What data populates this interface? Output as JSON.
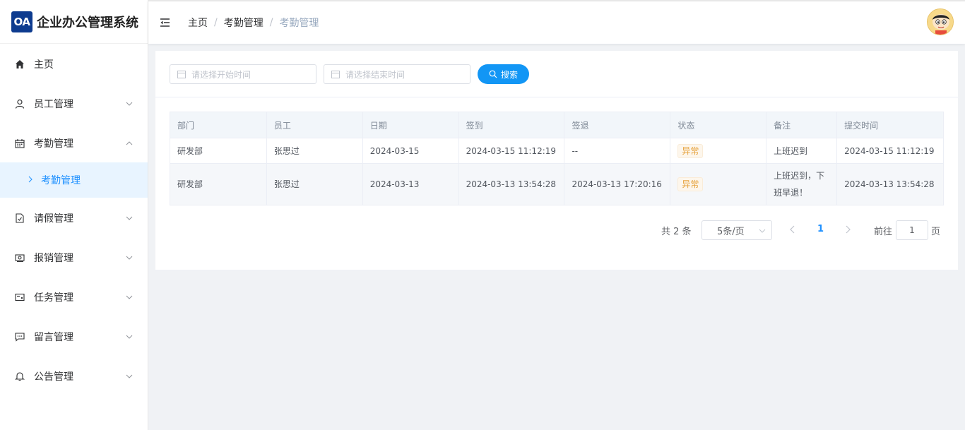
{
  "app": {
    "logo_badge": "OA",
    "title": "企业办公管理系统"
  },
  "sidebar": {
    "items": [
      {
        "label": "主页",
        "icon": "home-icon"
      },
      {
        "label": "员工管理",
        "icon": "user-icon"
      },
      {
        "label": "考勤管理",
        "icon": "calendar-icon"
      },
      {
        "label": "请假管理",
        "icon": "document-check-icon"
      },
      {
        "label": "报销管理",
        "icon": "money-icon"
      },
      {
        "label": "任务管理",
        "icon": "postcard-icon"
      },
      {
        "label": "留言管理",
        "icon": "chat-icon"
      },
      {
        "label": "公告管理",
        "icon": "bell-icon"
      }
    ],
    "active_sub": "考勤管理"
  },
  "breadcrumb": {
    "home": "主页",
    "parent": "考勤管理",
    "current": "考勤管理"
  },
  "filters": {
    "start_placeholder": "请选择开始时间",
    "end_placeholder": "请选择结束时间",
    "search_label": "搜索"
  },
  "table": {
    "headers": [
      "部门",
      "员工",
      "日期",
      "签到",
      "签退",
      "状态",
      "备注",
      "提交时间"
    ],
    "rows": [
      [
        "研发部",
        "张思过",
        "2024-03-15",
        "2024-03-15 11:12:19",
        "--",
        "异常",
        "上班迟到",
        "2024-03-15 11:12:19"
      ],
      [
        "研发部",
        "张思过",
        "2024-03-13",
        "2024-03-13 13:54:28",
        "2024-03-13 17:20:16",
        "异常",
        "上班迟到，下班早退！",
        "2024-03-13 13:54:28"
      ]
    ]
  },
  "pagination": {
    "total": "共 2 条",
    "page_size": "5条/页",
    "current_page": "1",
    "goto_label": "前往",
    "goto_value": "1",
    "goto_unit": "页"
  },
  "colors": {
    "accent": "#1296f5",
    "brand": "#0d3b8f",
    "warning": "#e6a23c"
  }
}
